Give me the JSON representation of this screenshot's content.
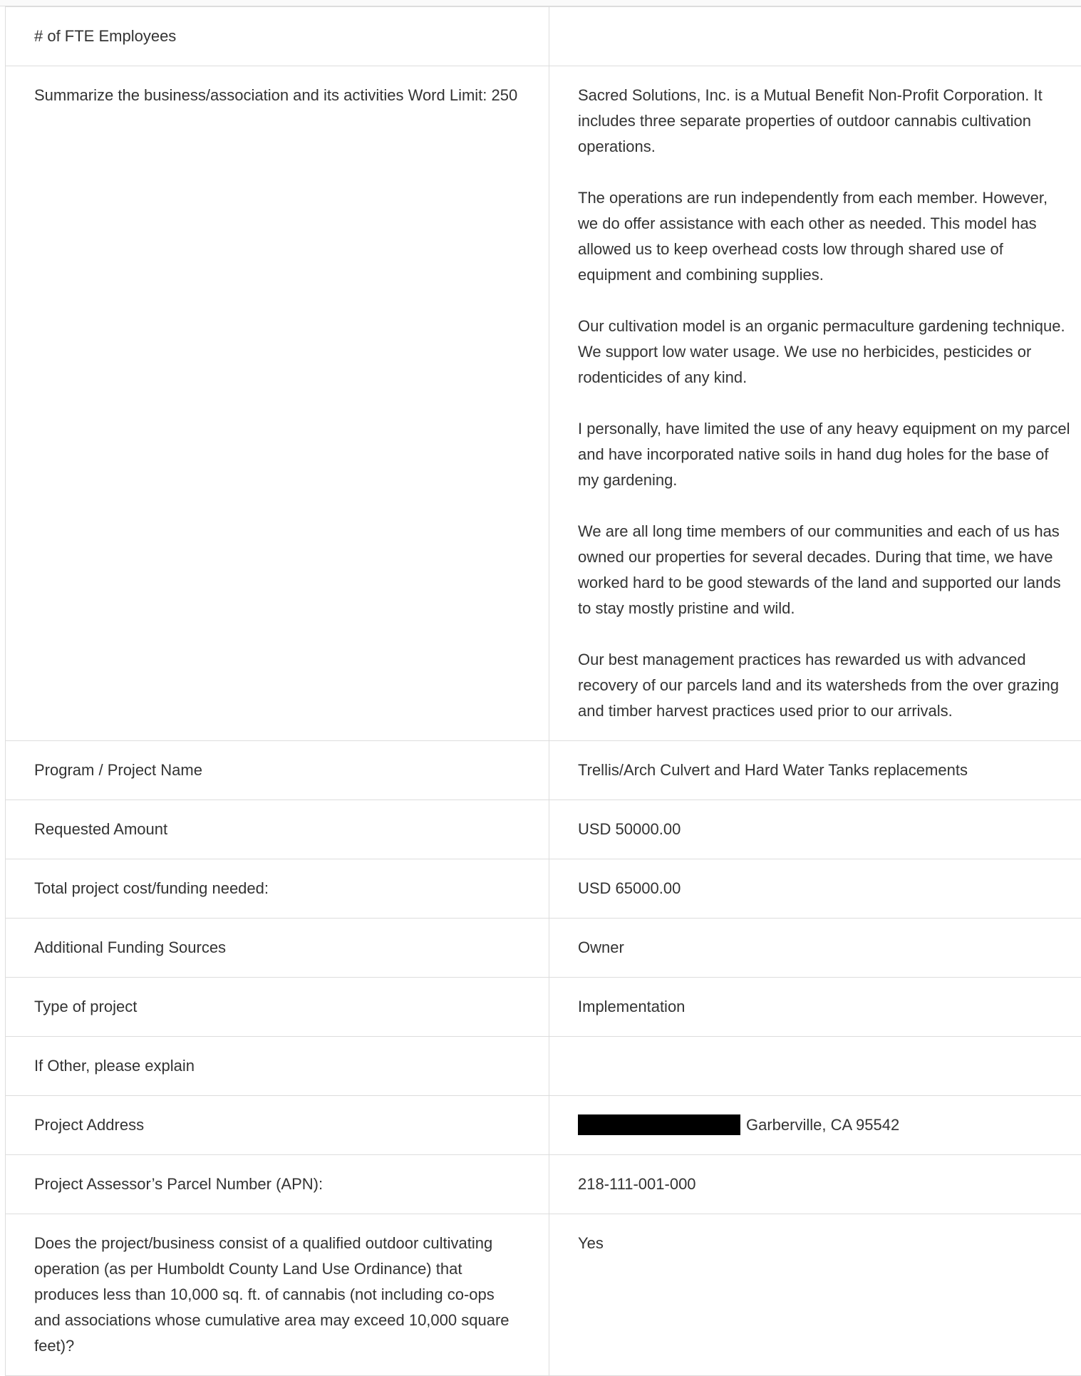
{
  "rows": [
    {
      "label": "# of FTE Employees",
      "value": ""
    },
    {
      "label": "Summarize the business/association and its activities Word Limit: 250",
      "paragraphs": [
        "Sacred Solutions, Inc. is a Mutual Benefit Non-Profit Corporation. It includes three separate properties of outdoor cannabis cultivation operations.",
        "The operations are run independently from each member. However, we do offer assistance with each other as needed. This model has allowed us to keep overhead costs low through shared use of equipment and combining supplies.",
        "Our cultivation model is an organic permaculture gardening technique. We support low water usage. We use no herbicides, pesticides or rodenticides of any kind.",
        "I personally, have limited the use of any heavy equipment on my parcel and have incorporated native soils in hand dug holes for the base of my gardening.",
        "We are all long time members of our communities and each of us has owned our properties for several decades. During that time, we have worked hard to be good stewards of the land and supported our lands to stay mostly pristine and wild.",
        "Our best management practices has rewarded us with advanced recovery of our parcels land and its watersheds from the over grazing and timber harvest practices used prior to our arrivals."
      ]
    },
    {
      "label": "Program / Project Name",
      "value": "Trellis/Arch Culvert and Hard Water Tanks replacements"
    },
    {
      "label": "Requested Amount",
      "value": "USD 50000.00"
    },
    {
      "label": "Total project cost/funding needed:",
      "value": "USD 65000.00"
    },
    {
      "label": "Additional Funding Sources",
      "value": "Owner"
    },
    {
      "label": "Type of project",
      "value": "Implementation"
    },
    {
      "label": "If Other, please explain",
      "value": ""
    },
    {
      "label": "Project Address",
      "value": "Garberville, CA 95542"
    },
    {
      "label": "Project Assessor’s Parcel Number (APN):",
      "value": "218-111-001-000"
    },
    {
      "label": "Does the project/business consist of a qualified outdoor cultivating operation (as per Humboldt County Land Use Ordinance) that produces less than 10,000 sq. ft. of cannabis (not including co-ops and associations whose cumulative area may exceed 10,000 square feet)?",
      "value": "Yes"
    }
  ]
}
